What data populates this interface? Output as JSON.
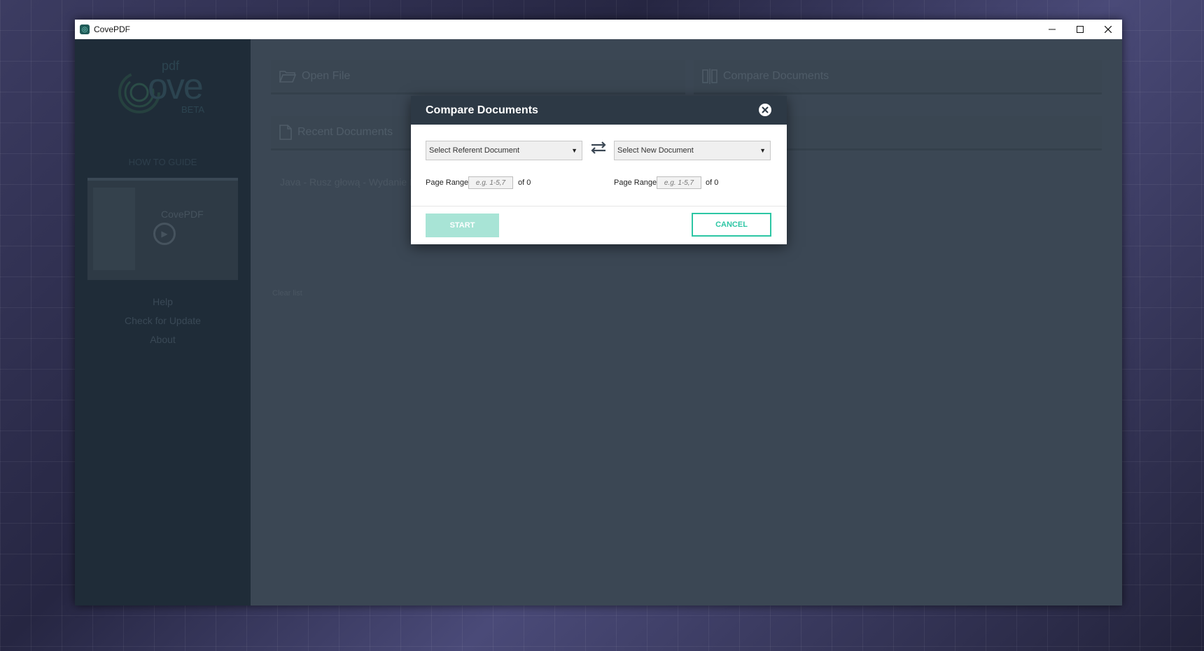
{
  "window": {
    "title": "CovePDF",
    "app_icon": "covepdf-app-icon",
    "controls": [
      "minimize-icon",
      "maximize-icon",
      "close-icon"
    ]
  },
  "sidebar": {
    "logo": {
      "main": "ove",
      "pdf": "pdf",
      "beta": "BETA"
    },
    "how_to_guide": "HOW TO GUIDE",
    "video_thumb_brand": "CovePDF",
    "links": [
      "Help",
      "Check for Update",
      "About"
    ]
  },
  "main": {
    "open_file": "Open File",
    "compare_documents": "Compare Documents",
    "recent_documents": "Recent Documents",
    "recent_items": [
      "Java - Rusz głową - Wydanie II"
    ],
    "clear_list": "Clear list"
  },
  "modal": {
    "title": "Compare Documents",
    "left_select": "Select Referent Document",
    "right_select": "Select New Document",
    "page_range_label": "Page Range",
    "page_range_placeholder": "e.g. 1-5,7",
    "of_label_left": "of 0",
    "of_label_right": "of 0",
    "start_label": "START",
    "cancel_label": "CANCEL"
  },
  "colors": {
    "accent": "#2dc6a4",
    "start_disabled": "#a8e4d6",
    "modal_header": "#2d3945",
    "sidebar": "#1f2c38",
    "main_bg": "#3b4754"
  }
}
